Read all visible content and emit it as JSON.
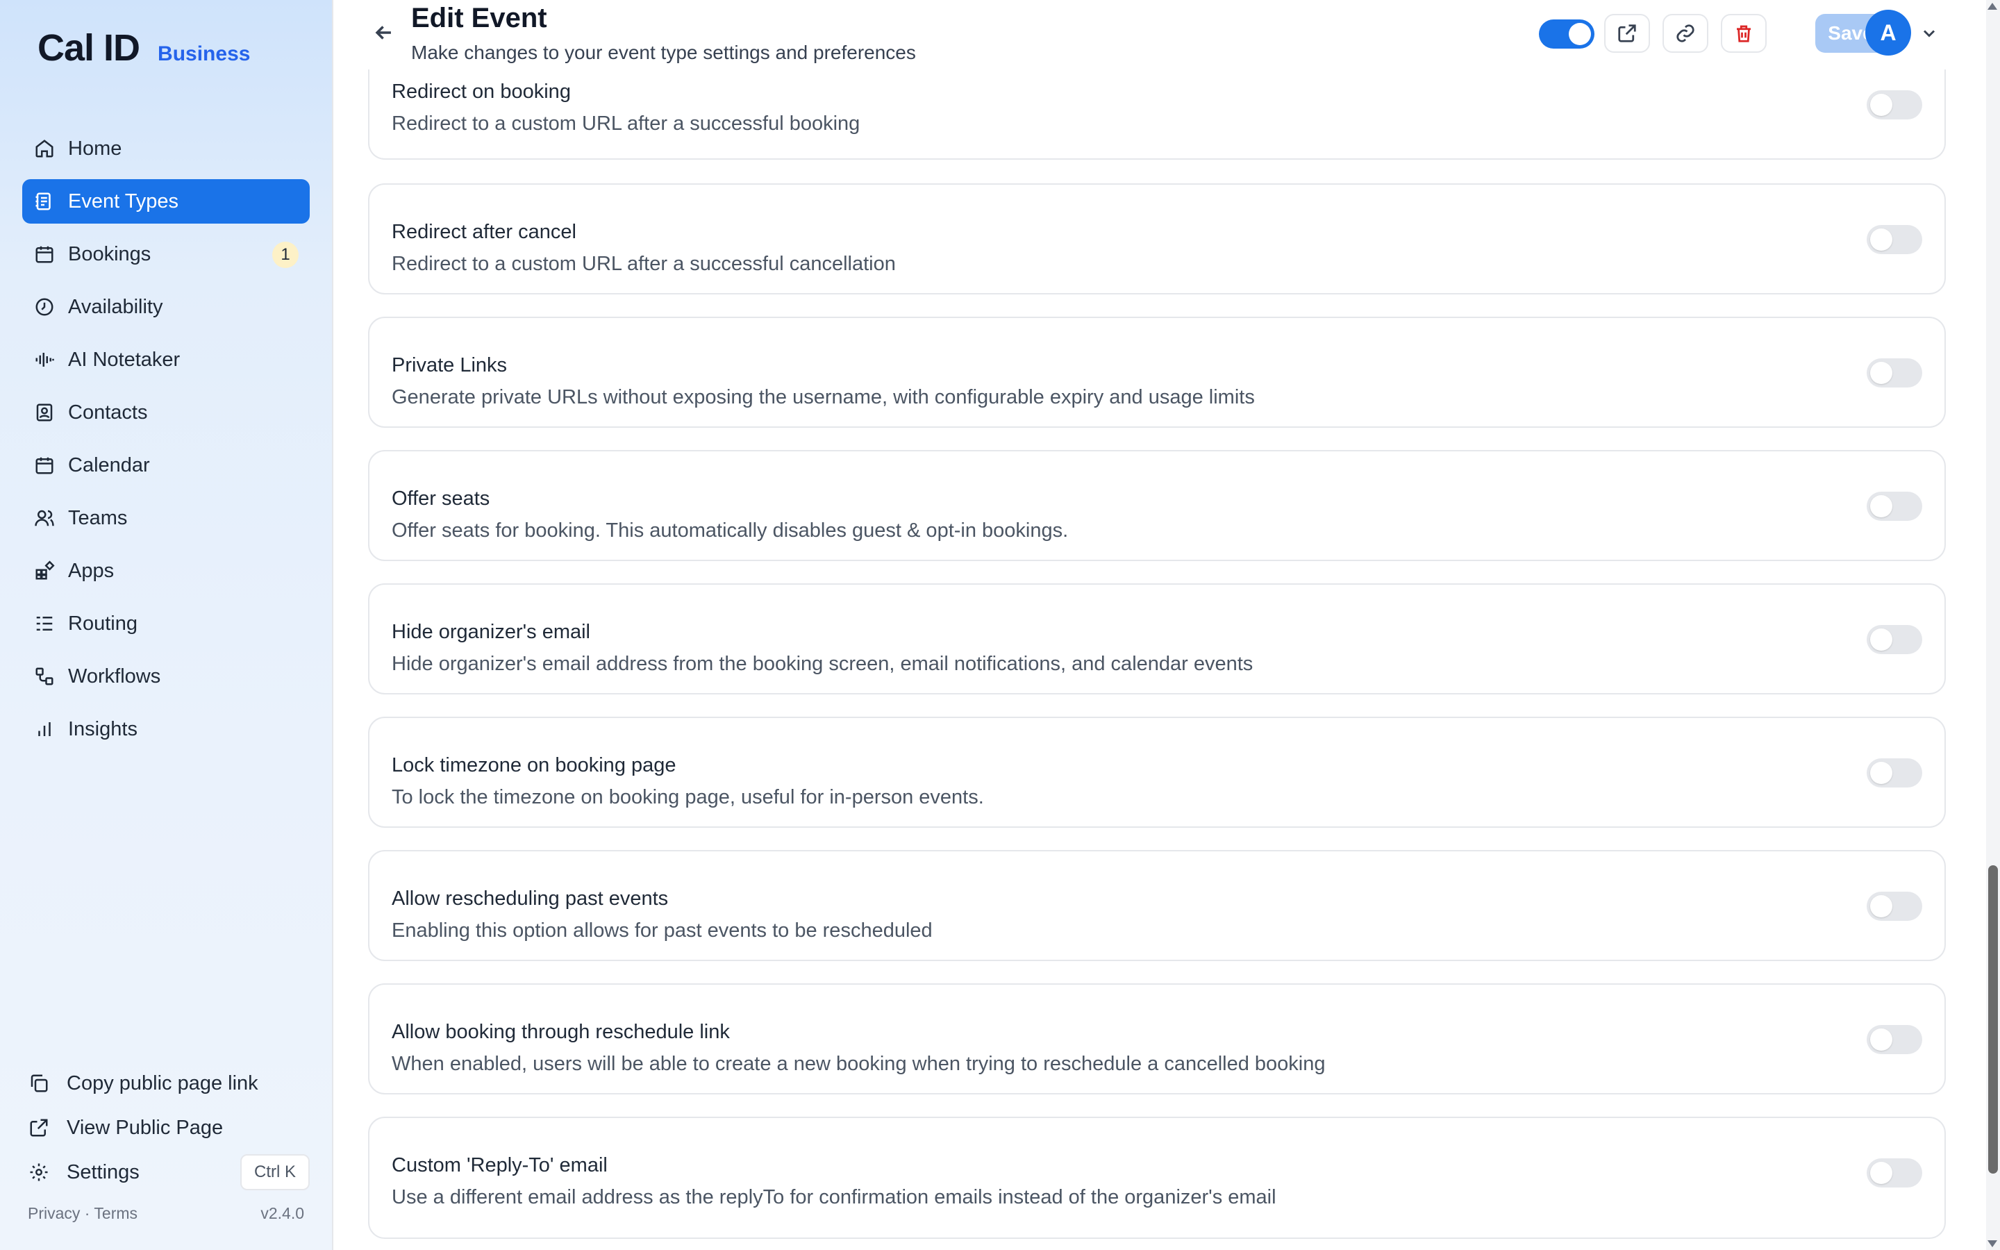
{
  "brand": {
    "logo": "Cal ID",
    "sub": "Business"
  },
  "nav": [
    {
      "label": "Home",
      "icon": "home-icon"
    },
    {
      "label": "Event Types",
      "icon": "event-types-icon",
      "active": true
    },
    {
      "label": "Bookings",
      "icon": "calendar-icon",
      "badge": "1"
    },
    {
      "label": "Availability",
      "icon": "clock-icon"
    },
    {
      "label": "AI Notetaker",
      "icon": "audio-wave-icon"
    },
    {
      "label": "Contacts",
      "icon": "contacts-icon"
    },
    {
      "label": "Calendar",
      "icon": "calendar-icon"
    },
    {
      "label": "Teams",
      "icon": "users-icon"
    },
    {
      "label": "Apps",
      "icon": "apps-icon"
    },
    {
      "label": "Routing",
      "icon": "routing-icon"
    },
    {
      "label": "Workflows",
      "icon": "workflows-icon"
    },
    {
      "label": "Insights",
      "icon": "bar-chart-icon"
    }
  ],
  "bottom": {
    "copy_link": "Copy public page link",
    "view_public": "View Public Page",
    "settings": "Settings",
    "shortcut": "Ctrl K"
  },
  "footer": {
    "links": "Privacy · Terms",
    "version": "v2.4.0"
  },
  "header": {
    "title": "Edit Event",
    "subtitle": "Make changes to your event type settings and preferences",
    "save": "Save",
    "avatar": "A",
    "event_enabled": true
  },
  "settings": [
    {
      "title": "Redirect on booking",
      "desc": "Redirect to a custom URL after a successful booking",
      "enabled": false
    },
    {
      "title": "Redirect after cancel",
      "desc": "Redirect to a custom URL after a successful cancellation",
      "enabled": false
    },
    {
      "title": "Private Links",
      "desc": "Generate private URLs without exposing the username, with configurable expiry and usage limits",
      "enabled": false
    },
    {
      "title": "Offer seats",
      "desc": "Offer seats for booking. This automatically disables guest & opt-in bookings.",
      "enabled": false
    },
    {
      "title": "Hide organizer's email",
      "desc": "Hide organizer's email address from the booking screen, email notifications, and calendar events",
      "enabled": false
    },
    {
      "title": "Lock timezone on booking page",
      "desc": "To lock the timezone on booking page, useful for in-person events.",
      "enabled": false
    },
    {
      "title": "Allow rescheduling past events",
      "desc": "Enabling this option allows for past events to be rescheduled",
      "enabled": false
    },
    {
      "title": "Allow booking through reschedule link",
      "desc": "When enabled, users will be able to create a new booking when trying to reschedule a cancelled booking",
      "enabled": false
    },
    {
      "title": "Custom 'Reply-To' email",
      "desc": "Use a different email address as the replyTo for confirmation emails instead of the organizer's email",
      "enabled": false
    }
  ],
  "colors": {
    "accent": "#1a73e8",
    "badge": "#fdf1c7",
    "danger": "#dc2626"
  }
}
